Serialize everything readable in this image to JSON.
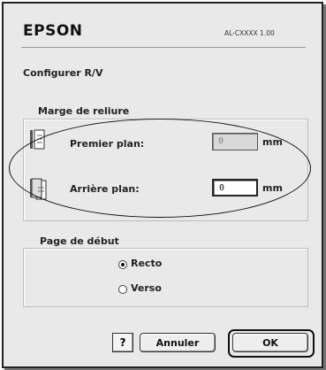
{
  "header": {
    "brand": "EPSON",
    "model": "AL-CXXXX 1.00"
  },
  "dialog_title": "Configurer R/V",
  "binding_margin": {
    "legend": "Marge de reliure",
    "front": {
      "label": "Premier plan:",
      "value": "0",
      "unit": "mm",
      "enabled": false,
      "icon": "page-front-icon"
    },
    "back": {
      "label": "Arrière plan:",
      "value": "0",
      "unit": "mm",
      "enabled": true,
      "icon": "page-back-icon"
    }
  },
  "start_page": {
    "legend": "Page de début",
    "options": [
      {
        "label": "Recto",
        "selected": true
      },
      {
        "label": "Verso",
        "selected": false
      }
    ]
  },
  "buttons": {
    "help": "?",
    "cancel": "Annuler",
    "ok": "OK"
  },
  "colors": {
    "dialog_bg": "#e9e9e9",
    "border": "#222222",
    "annotation_oval": "#111111"
  }
}
